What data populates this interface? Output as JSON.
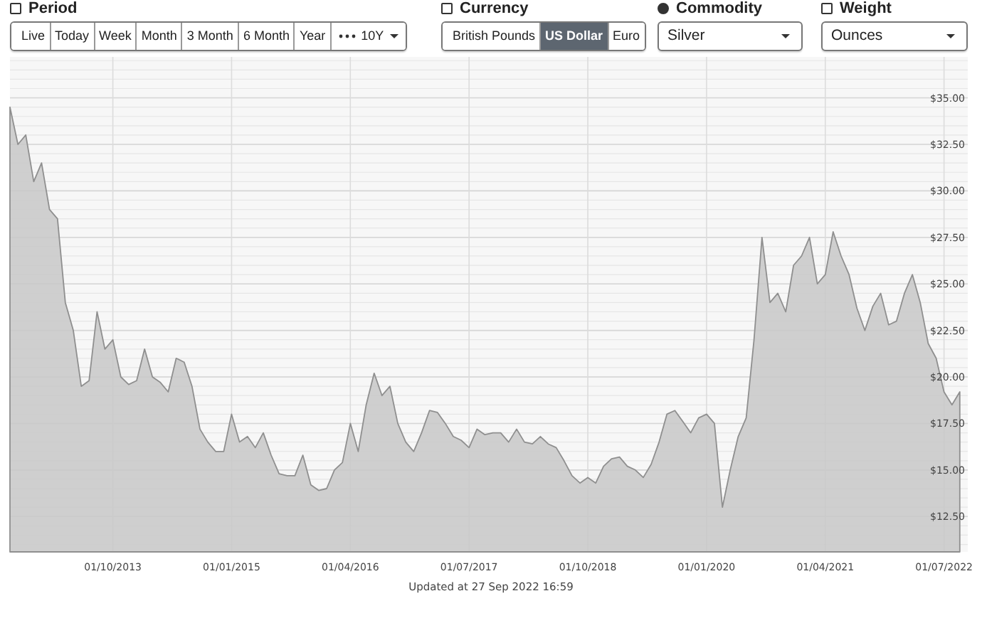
{
  "period": {
    "label": "Period",
    "options": [
      {
        "label": "Live",
        "selected": false
      },
      {
        "label": "Today",
        "selected": false
      },
      {
        "label": "Week",
        "selected": false
      },
      {
        "label": "Month",
        "selected": false
      },
      {
        "label": "3 Month",
        "selected": false
      },
      {
        "label": "6 Month",
        "selected": false
      },
      {
        "label": "Year",
        "selected": false
      }
    ],
    "more": {
      "label": "10Y"
    }
  },
  "currency": {
    "label": "Currency",
    "options": [
      {
        "label": "British Pounds",
        "selected": false
      },
      {
        "label": "US Dollar",
        "selected": true
      },
      {
        "label": "Euro",
        "selected": false
      }
    ]
  },
  "commodity": {
    "label": "Commodity",
    "value": "Silver"
  },
  "weight": {
    "label": "Weight",
    "value": "Ounces"
  },
  "chart": {
    "chart_data": {
      "type": "area",
      "categories": [
        null,
        null,
        null,
        null,
        null,
        null,
        null,
        null,
        null,
        null,
        null,
        null,
        null,
        "01/10/2013",
        null,
        null,
        null,
        null,
        null,
        null,
        null,
        null,
        null,
        null,
        null,
        null,
        null,
        null,
        "01/01/2015",
        null,
        null,
        null,
        null,
        null,
        null,
        null,
        null,
        null,
        null,
        null,
        null,
        null,
        null,
        "01/04/2016",
        null,
        null,
        null,
        null,
        null,
        null,
        null,
        null,
        null,
        null,
        null,
        null,
        null,
        null,
        "01/07/2017",
        null,
        null,
        null,
        null,
        null,
        null,
        null,
        null,
        null,
        null,
        null,
        null,
        null,
        null,
        "01/10/2018",
        null,
        null,
        null,
        null,
        null,
        null,
        null,
        null,
        null,
        null,
        null,
        null,
        null,
        null,
        "01/01/2020",
        null,
        null,
        null,
        null,
        null,
        null,
        null,
        null,
        null,
        null,
        null,
        null,
        null,
        null,
        "01/04/2021",
        null,
        null,
        null,
        null,
        null,
        null,
        null,
        null,
        null,
        null,
        null,
        null,
        null,
        null,
        "01/07/2022",
        null,
        null
      ],
      "series": [
        {
          "color": "#c8c8c8",
          "values": [
            34.5,
            32.5,
            33,
            30.5,
            31.5,
            29,
            28.5,
            24,
            22.5,
            19.5,
            19.8,
            23.5,
            21.5,
            22,
            20,
            19.6,
            19.8,
            21.5,
            20,
            19.7,
            19.2,
            21,
            20.8,
            19.5,
            17.2,
            16.5,
            16,
            16,
            18,
            16.5,
            16.8,
            16.2,
            17,
            15.8,
            14.8,
            14.7,
            14.7,
            15.8,
            14.2,
            13.9,
            14,
            15,
            15.4,
            17.5,
            16,
            18.5,
            20.2,
            19,
            19.5,
            17.5,
            16.5,
            16,
            17,
            18.2,
            18.1,
            17.5,
            16.8,
            16.6,
            16.2,
            17.2,
            16.9,
            17,
            17,
            16.5,
            17.2,
            16.5,
            16.4,
            16.8,
            16.4,
            16.2,
            15.5,
            14.7,
            14.3,
            14.6,
            14.3,
            15.2,
            15.6,
            15.7,
            15.2,
            15,
            14.6,
            15.3,
            16.5,
            18,
            18.2,
            17.6,
            17,
            17.8,
            18,
            17.5,
            13,
            15,
            16.8,
            17.8,
            22,
            27.5,
            24,
            24.5,
            23.5,
            26,
            26.5,
            27.5,
            25,
            25.5,
            27.8,
            26.5,
            25.5,
            23.7,
            22.5,
            23.8,
            24.5,
            22.8,
            23,
            24.5,
            25.5,
            24,
            21.8,
            21,
            19.2,
            18.5,
            19.2
          ]
        }
      ],
      "ylim": [
        10.6,
        37.2
      ],
      "grid": true,
      "yticks": [
        {
          "value": 12.5,
          "label": "$12.50"
        },
        {
          "value": 15,
          "label": "$15.00"
        },
        {
          "value": 17.5,
          "label": "$17.50"
        },
        {
          "value": 20,
          "label": "$20.00"
        },
        {
          "value": 22.5,
          "label": "$22.50"
        },
        {
          "value": 25,
          "label": "$25.00"
        },
        {
          "value": 27.5,
          "label": "$27.50"
        },
        {
          "value": 30,
          "label": "$30.00"
        },
        {
          "value": 32.5,
          "label": "$32.50"
        },
        {
          "value": 35,
          "label": "$35.00"
        }
      ]
    }
  },
  "updated": "Updated at 27 Sep 2022 16:59"
}
